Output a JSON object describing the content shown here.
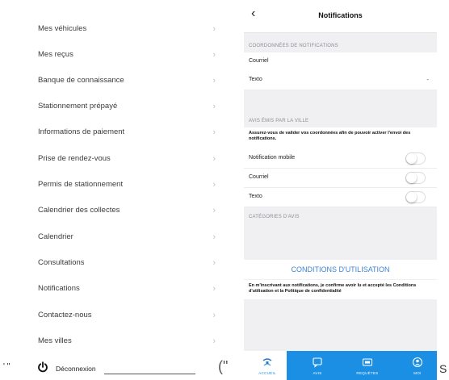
{
  "menu": {
    "items": [
      {
        "label": "Mes véhicules"
      },
      {
        "label": "Mes reçus"
      },
      {
        "label": "Banque de connaissance"
      },
      {
        "label": "Stationnement prépayé"
      },
      {
        "label": "Informations de paiement"
      },
      {
        "label": "Prise de rendez-vous"
      },
      {
        "label": "Permis de stationnement"
      },
      {
        "label": "Calendrier des collectes"
      },
      {
        "label": "Calendrier"
      },
      {
        "label": "Consultations"
      },
      {
        "label": "Notifications"
      },
      {
        "label": "Contactez-nous"
      },
      {
        "label": "Mes villes"
      }
    ],
    "chevron": "›",
    "logout_label": "Déconnexion",
    "quote_left": "' \"",
    "quote_right": "(\""
  },
  "notifications": {
    "back": "‹",
    "title": "Notifications",
    "contact_section": "COORDONNÉES DE NOTIFICATIONS",
    "email_label": "Courriel",
    "text_label": "Texto",
    "text_value": "-",
    "city_section": "AVIS ÉMIS PAR LA VILLE",
    "city_notice": "Assurez-vous de valider vos coordonnées afin de pouvoir activer l'envoi des notifications.",
    "toggles": [
      {
        "label": "Notification mobile",
        "on": false
      },
      {
        "label": "Courriel",
        "on": false
      },
      {
        "label": "Texto",
        "on": false
      }
    ],
    "categories_section": "CATÉGORIES D'AVIS",
    "conditions_link": "CONDITIONS D'UTILISATION",
    "conditions_notice": "En m'inscrivant aux notifications, je confirme avoir lu et accepté les Conditions d'utilisation et la Politique de confidentialité"
  },
  "tabbar": {
    "tabs": [
      {
        "label": "ACCUEIL",
        "icon": "home-logo-icon",
        "active": true
      },
      {
        "label": "AVIS",
        "icon": "chat-icon",
        "active": false
      },
      {
        "label": "REQUÊTES",
        "icon": "ticket-icon",
        "active": false
      },
      {
        "label": "MOI",
        "icon": "user-icon",
        "active": false
      }
    ]
  },
  "edge_letter": "S",
  "colors": {
    "accent": "#1a8fe3",
    "link": "#3c83d6",
    "section_bg": "#f0f0f3"
  }
}
